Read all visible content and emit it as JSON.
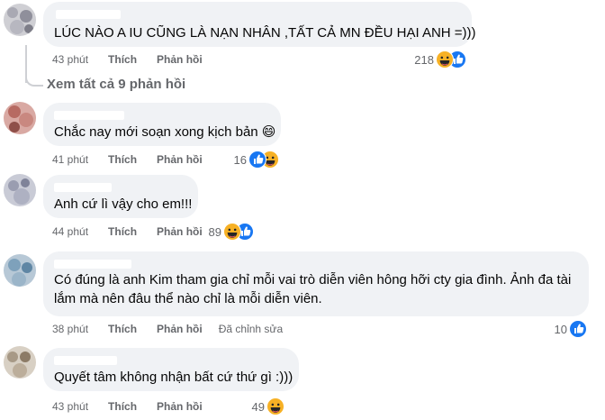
{
  "action_like": "Thích",
  "action_reply": "Phản hồi",
  "view_all_replies": "Xem tất cả 9 phản hồi",
  "colors": {
    "like": "#1877f2",
    "haha": "#f7b125",
    "bubble": "#f0f2f5",
    "meta": "#65676b"
  },
  "comments": [
    {
      "text": "LÚC NÀO A IU CŨNG LÀ NẠN NHÂN ,TẤT CẢ MN ĐỀU HẠI ANH =)))",
      "time": "43 phút",
      "reactions": "218",
      "reaction_icons": [
        "haha-icon",
        "like-icon"
      ]
    },
    {
      "text": "Chắc nay mới soạn xong kịch bản 😄",
      "time": "41 phút",
      "reactions": "16",
      "reaction_icons": [
        "like-icon",
        "haha-icon"
      ]
    },
    {
      "text": "Anh cứ lì vậy cho em!!!",
      "time": "44 phút",
      "reactions": "89",
      "reaction_icons": [
        "haha-icon",
        "like-icon"
      ]
    },
    {
      "text_lines": [
        "Có đúng là anh Kim tham gia chỉ mỗi vai trò diễn viên hông hỡi cty gia đình. Ảnh đa tài",
        "lắm mà nên đâu thể nào chỉ là mỗi diễn viên."
      ],
      "time": "38 phút",
      "edited": "Đã chỉnh sửa",
      "reactions": "10",
      "reaction_icons": [
        "like-icon"
      ]
    },
    {
      "text": "Quyết tâm không nhận bất cứ thứ gì :)))",
      "time": "43 phút",
      "reactions": "49",
      "reaction_icons": [
        "haha-icon"
      ]
    }
  ]
}
